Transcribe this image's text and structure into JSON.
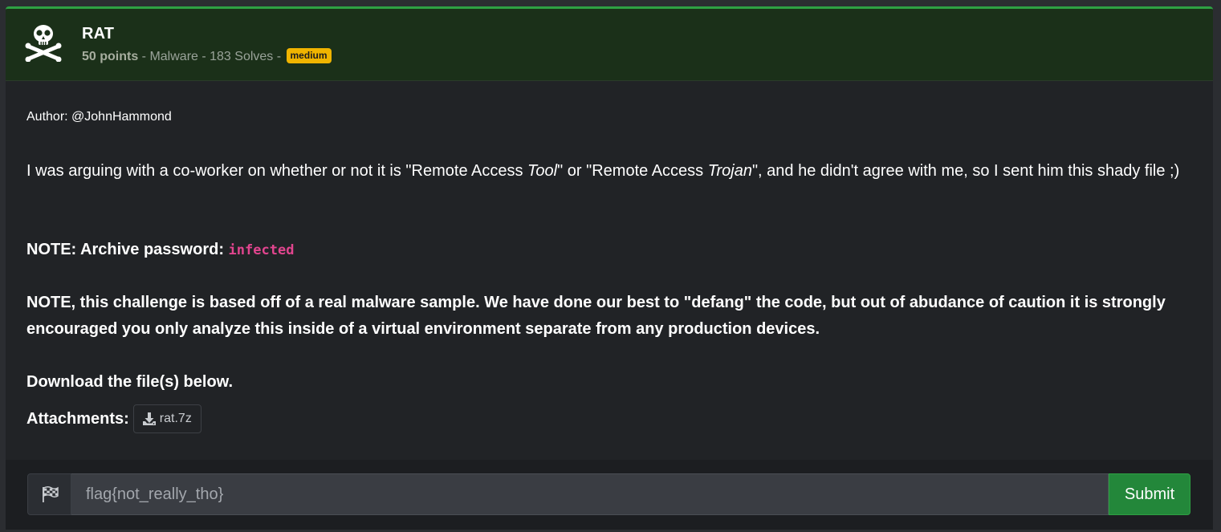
{
  "challenge": {
    "title": "RAT",
    "points": "50 points",
    "meta_rest": " - Malware - 183 Solves - ",
    "difficulty": "medium",
    "icon": "skull-crossbones-icon"
  },
  "description": {
    "author": "Author: @JohnHammond",
    "para1_a": "I was arguing with a co-worker on whether or not it is \"Remote Access ",
    "para1_b": "Tool",
    "para1_c": "\" or \"Remote Access ",
    "para1_d": "Trojan",
    "para1_e": "\", and he didn't agree with me, so I sent him this shady file ;)",
    "note1_label": "NOTE: Archive password: ",
    "note1_code": "infected",
    "note2": "NOTE, this challenge is based off of a real malware sample. We have done our best to \"defang\" the code, but out of abudance of caution it is strongly encouraged you only analyze this inside of a virtual environment separate from any production devices.",
    "download": "Download the file(s) below."
  },
  "attachments": {
    "label": "Attachments:",
    "files": [
      {
        "name": "rat.7z",
        "icon": "download-icon"
      }
    ]
  },
  "flag_form": {
    "icon": "checkered-flag-icon",
    "placeholder": "flag{not_really_tho}",
    "submit_label": "Submit"
  },
  "colors": {
    "header_bg": "#1b3019",
    "accent": "#2ea043",
    "badge": "#f0b400",
    "code": "#e2458f"
  }
}
